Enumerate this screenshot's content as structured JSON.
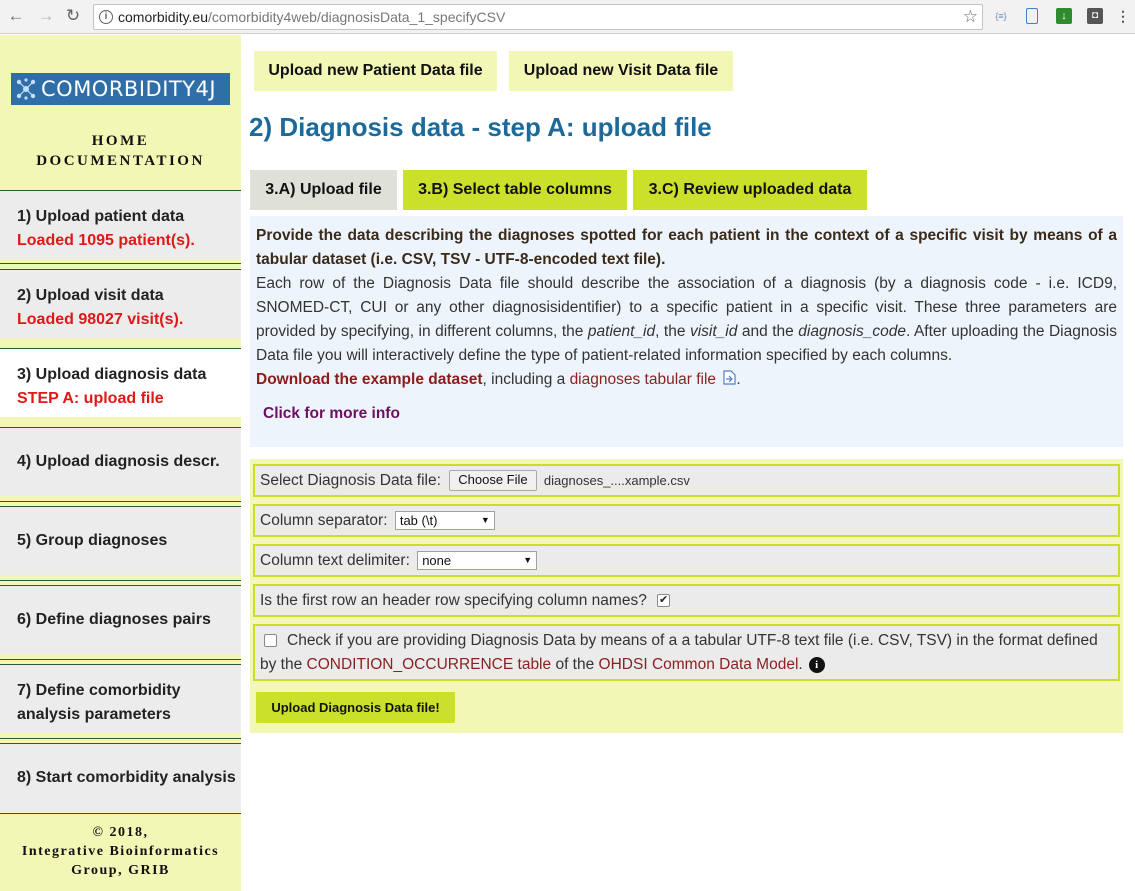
{
  "browser": {
    "url_host": "comorbidity.eu",
    "url_path": "/comorbidity4web/diagnosisData_1_specifyCSV"
  },
  "sidebar": {
    "logo_text": "COMORBIDITY4J",
    "home_label": "HOME",
    "documentation_label": "DOCUMENTATION",
    "items": [
      {
        "label": "1) Upload patient data",
        "status": "Loaded 1095 patient(s)."
      },
      {
        "label": "2) Upload visit data",
        "status": "Loaded 98027 visit(s)."
      },
      {
        "label": "3) Upload diagnosis data",
        "status": "STEP A: upload file"
      },
      {
        "label": "4) Upload diagnosis descr."
      },
      {
        "label": "5) Group diagnoses"
      },
      {
        "label": "6) Define diagnoses pairs"
      },
      {
        "label": "7) Define comorbidity",
        "label2": "analysis parameters"
      },
      {
        "label": "8) Start comorbidity analysis"
      }
    ],
    "footer_line1": "© 2018,",
    "footer_line2": "Integrative Bioinformatics",
    "footer_line3": "Group, GRIB"
  },
  "top_buttons": {
    "patient": "Upload new Patient Data file",
    "visit": "Upload new Visit Data file"
  },
  "page_title": "2) Diagnosis data - step A: upload file",
  "tabs": [
    {
      "label": "3.A) Upload file"
    },
    {
      "label": "3.B) Select table columns"
    },
    {
      "label": "3.C) Review uploaded data"
    }
  ],
  "description": {
    "bold": "Provide the data describing the diagnoses spotted for each patient in the context of a specific visit by means of a tabular dataset (i.e. CSV, TSV - UTF-8-encoded text file).",
    "p1": "Each row of the Diagnosis Data file should describe the association of a diagnosis (by a diagnosis code - i.e. ICD9, SNOMED-CT, CUI or any other diagnosisidentifier) to a specific patient in a specific visit. These three parameters are provided by specifying, in different columns, the ",
    "patient_id": "patient_id",
    "sep1": ", the ",
    "visit_id": "visit_id",
    "sep2": " and the ",
    "diagnosis_code": "diagnosis_code",
    "p2": ". After uploading the Diagnosis Data file you will interactively define the type of patient-related information specified by each columns.",
    "download_link": "Download the example dataset",
    "including": ", including a ",
    "tabular_link": "diagnoses tabular file",
    "period": ".",
    "more_info": "Click for more info"
  },
  "form": {
    "file_label": "Select Diagnosis Data file:",
    "choose_file": "Choose File",
    "file_name": "diagnoses_....xample.csv",
    "separator_label": "Column separator:",
    "separator_value": "tab (\\t)",
    "delimiter_label": "Column text delimiter:",
    "delimiter_value": "none",
    "header_label": "Is the first row an header row specifying column names?",
    "header_checked": true,
    "omop_label_1": "Check if you are providing Diagnosis Data by means of a a tabular UTF-8 text file (i.e. CSV, TSV) in the format defined by the ",
    "omop_link_1": "CONDITION_OCCURRENCE table",
    "omop_label_2": " of the ",
    "omop_link_2": "OHDSI Common Data Model",
    "omop_label_3": ".",
    "submit": "Upload Diagnosis Data file!"
  }
}
